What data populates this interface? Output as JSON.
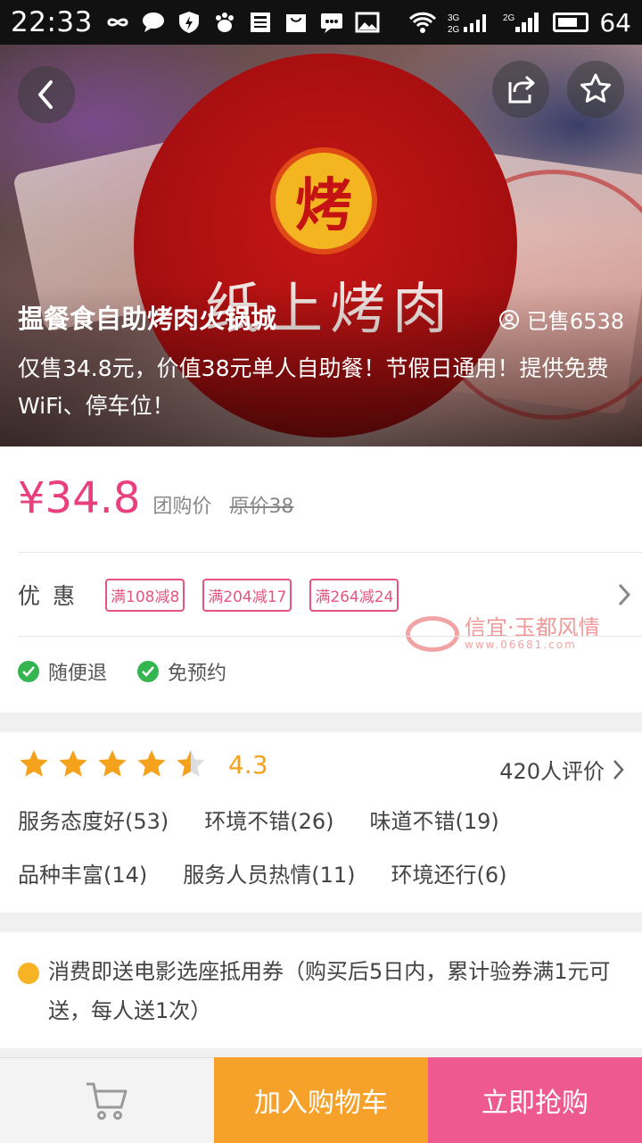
{
  "status_bar": {
    "time": "22:33",
    "battery_level": "64",
    "icons": [
      "infinity-icon",
      "chat-icon",
      "shield-icon",
      "paw-icon",
      "news-icon",
      "bag-icon",
      "message-icon",
      "image-icon",
      "wifi-icon",
      "signal-3g-icon",
      "signal-2g-icon",
      "battery-icon"
    ]
  },
  "hero": {
    "logo_badge": "烤",
    "logo_text": "纸上烤肉",
    "title": "揾餐食自助烤肉火锅城",
    "sold": "已售6538",
    "description": "仅售34.8元，价值38元单人自助餐！节假日通用！提供免费WiFi、停车位！"
  },
  "price": {
    "amount": "¥34.8",
    "tag": "团购价",
    "original": "原价38"
  },
  "promo": {
    "label": "优惠",
    "tags": [
      "满108减8",
      "满204减17",
      "满264减24"
    ]
  },
  "watermark": {
    "text": "信宜·玉都风情",
    "url": "www.06681.com"
  },
  "guarantees": [
    "随便退",
    "免预约"
  ],
  "rating": {
    "stars": 4.3,
    "score": "4.3",
    "reviews": "420人评价",
    "keywords_row1": [
      "服务态度好(53)",
      "环境不错(26)",
      "味道不错(19)"
    ],
    "keywords_row2": [
      "品种丰富(14)",
      "服务人员热情(11)",
      "环境还行(6)"
    ]
  },
  "gift": {
    "text": "消费即送电影选座抵用券（购买后5日内，累计验券满1元可送，每人送1次）"
  },
  "bottom_bar": {
    "add_cart": "加入购物车",
    "buy_now": "立即抢购"
  },
  "colors": {
    "price": "#e9407d",
    "add_cart_bg": "#f6a12a",
    "buy_bg": "#ef5a8e",
    "star": "#f4a21c",
    "check": "#34b54f"
  }
}
